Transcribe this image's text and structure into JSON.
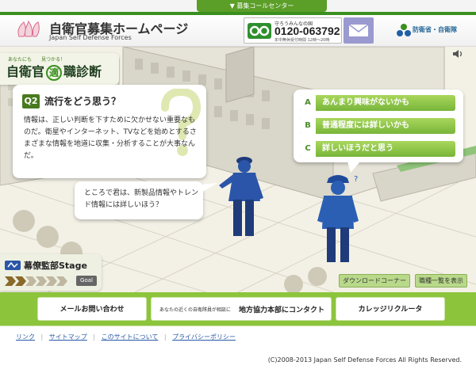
{
  "top": {
    "tab_label": "▼ 募集コールセンター"
  },
  "header": {
    "title": "自衛官募集ホームページ",
    "subtitle": "Japan Self Defense Forces",
    "phone_label": "守ろうみんなの国",
    "phone_number": "0120-063792",
    "phone_hours": "年中無休受付時間 12時〜20時",
    "ministry": "防衛省・自衛隊"
  },
  "quiz": {
    "banner_top": "あなたにも　　見つかる！",
    "banner_main_a": "自衛官",
    "banner_main_b": "適",
    "banner_main_c": "職診断",
    "question_no": "Q2",
    "question_title": "流行をどう思う？",
    "question_body": "情報は、正しい判断を下すために欠かせない重要なものだ。衛星やインターネット、TVなどを始めとするさまざまな情報を地道に収集・分析することが大事なんだ。",
    "speech": "ところで君は、新製品情報やトレンド情報には詳しいほう？",
    "answers": [
      {
        "letter": "A",
        "text": "あんまり興味がないかも"
      },
      {
        "letter": "B",
        "text": "普通程度には詳しいかも"
      },
      {
        "letter": "C",
        "text": "詳しいほうだと思う"
      }
    ],
    "stage_label": "幕僚監部Stage",
    "goal_label": "Goal",
    "download_label": "ダウンロードコーナー",
    "joblist_label": "職種一覧を表示",
    "sound_icon": "speaker-icon"
  },
  "nav": {
    "mail": "メールお問い合わせ",
    "contact_small": "あなたの近くの自衛隊員が相談に",
    "contact_main": "地方協力本部にコンタクト",
    "college": "カレッジリクルータ"
  },
  "footer": {
    "links": [
      "リンク",
      "サイトマップ",
      "このサイトについて",
      "プライバシーポリシー"
    ],
    "copyright": "(C)2008-2013 Japan Self Defense Forces All Rights Reserved."
  },
  "colors": {
    "accent": "#8cc43c",
    "header_green": "#3a8f1f",
    "answer_green": "#78b53a"
  }
}
